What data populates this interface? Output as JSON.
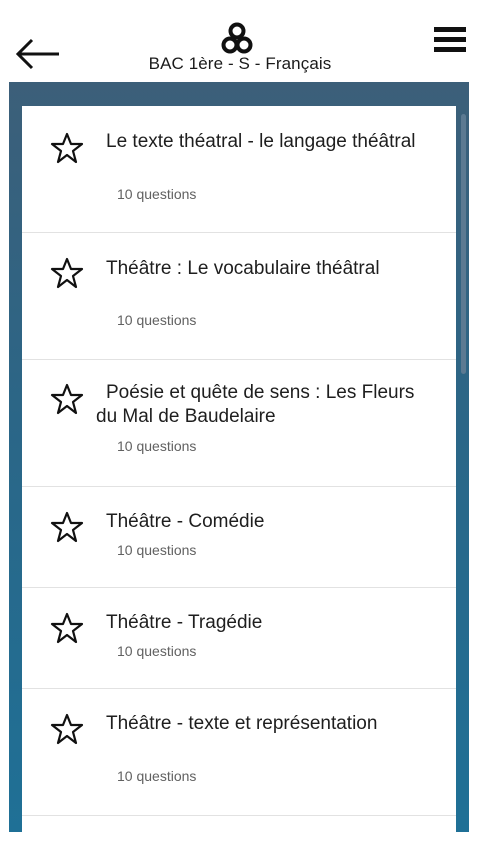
{
  "header": {
    "subtitle": "BAC 1ère - S - Français",
    "back_icon": "arrow-left-icon",
    "menu_icon": "hamburger-menu-icon",
    "logo_icon": "app-logo-icon"
  },
  "colors": {
    "panel_top": "#3c5f79",
    "panel_bottom": "#1f7096",
    "text": "#1e1e1e",
    "meta": "#616161"
  },
  "items": [
    {
      "title": "Le texte théatral - le langage théâtral",
      "meta": "10 questions",
      "icon": "star-outline-icon"
    },
    {
      "title": "Théâtre : Le vocabulaire théâtral",
      "meta": "10 questions",
      "icon": "star-outline-icon"
    },
    {
      "title": "Poésie et quête de sens : Les Fleurs du Mal de Baudelaire",
      "meta": "10 questions",
      "icon": "star-outline-icon"
    },
    {
      "title": "Théâtre - Comédie",
      "meta": "10 questions",
      "icon": "star-outline-icon"
    },
    {
      "title": "Théâtre - Tragédie",
      "meta": "10 questions",
      "icon": "star-outline-icon"
    },
    {
      "title": "Théâtre - texte et représentation",
      "meta": "10 questions",
      "icon": "star-outline-icon"
    }
  ]
}
